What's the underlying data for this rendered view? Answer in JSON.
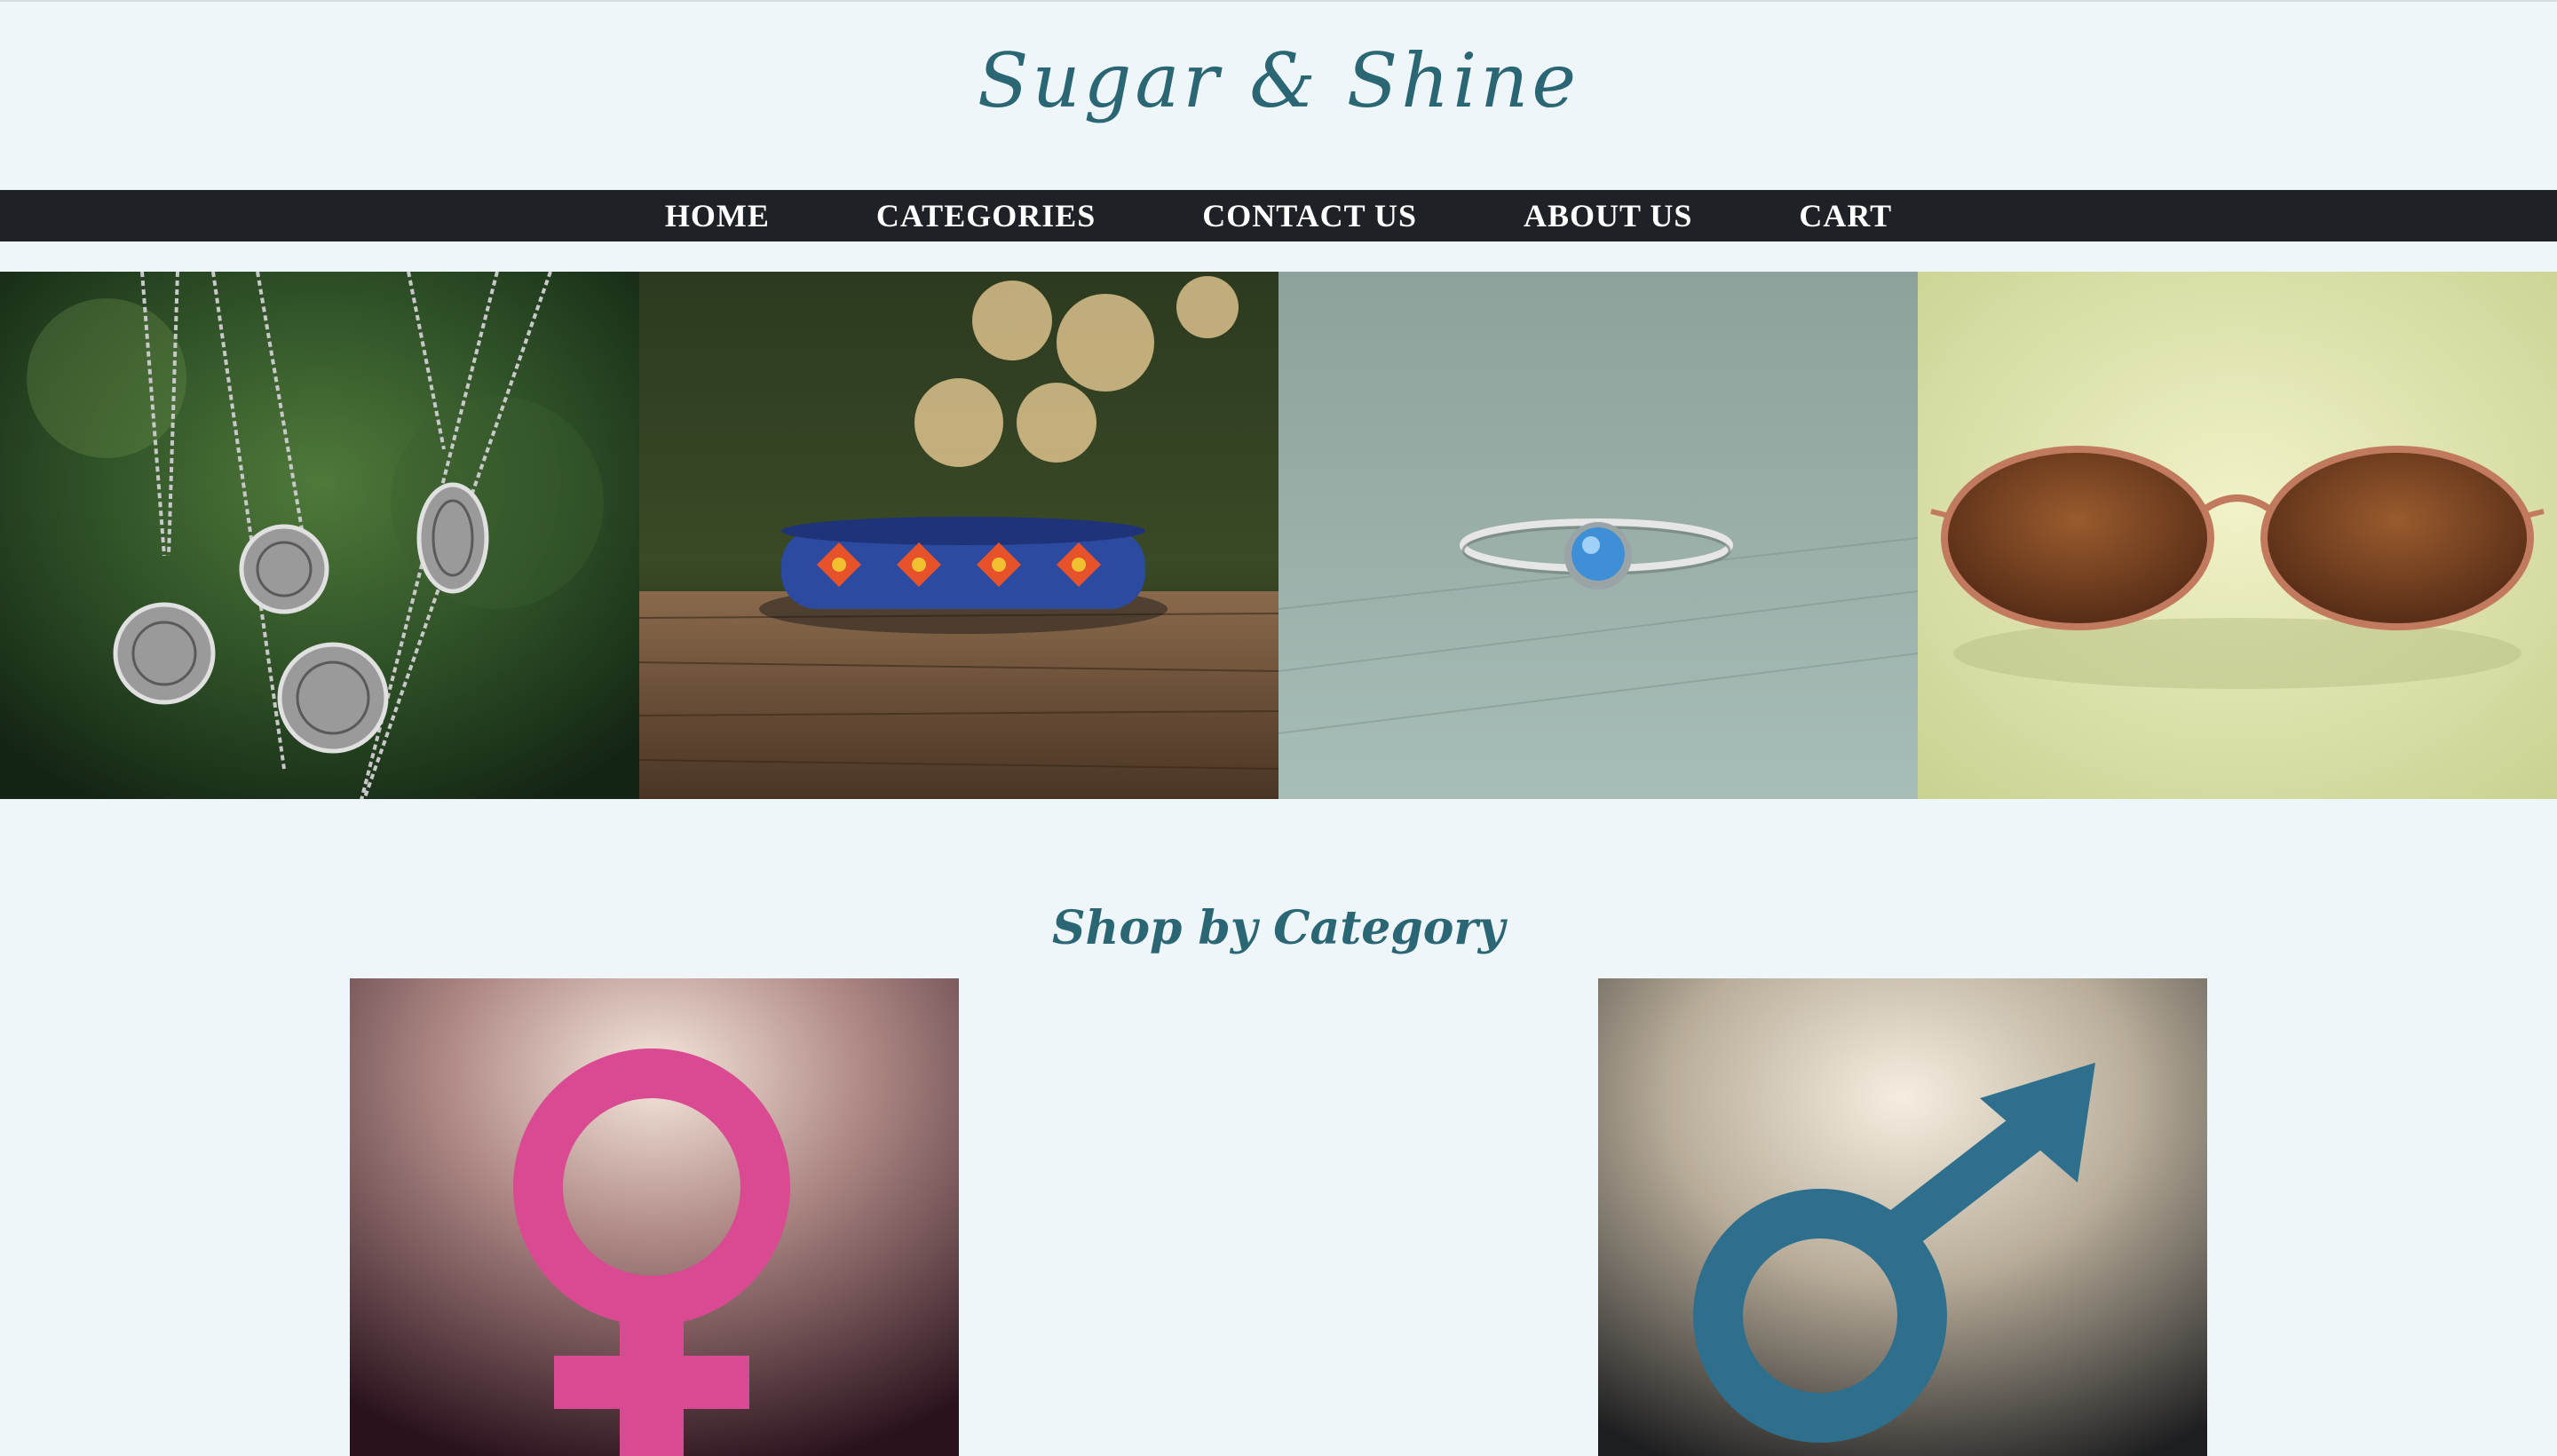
{
  "brand": {
    "title": "Sugar & Shine"
  },
  "nav": {
    "items": [
      {
        "label": "HOME"
      },
      {
        "label": "CATEGORIES"
      },
      {
        "label": "CONTACT US"
      },
      {
        "label": "ABOUT US"
      },
      {
        "label": "CART"
      }
    ]
  },
  "hero": {
    "tiles": [
      {
        "icon": "necklace-image"
      },
      {
        "icon": "beaded-bracelet-image"
      },
      {
        "icon": "ring-image"
      },
      {
        "icon": "sunglasses-image"
      }
    ]
  },
  "categories": {
    "title": "Shop by Category",
    "items": [
      {
        "icon": "female-symbol-icon",
        "color": "#d94a93"
      },
      {
        "icon": "male-symbol-icon",
        "color": "#2f6f8e"
      }
    ]
  },
  "colors": {
    "background": "#eef6fa",
    "brand": "#2a6673",
    "navbar": "#1e2126"
  }
}
